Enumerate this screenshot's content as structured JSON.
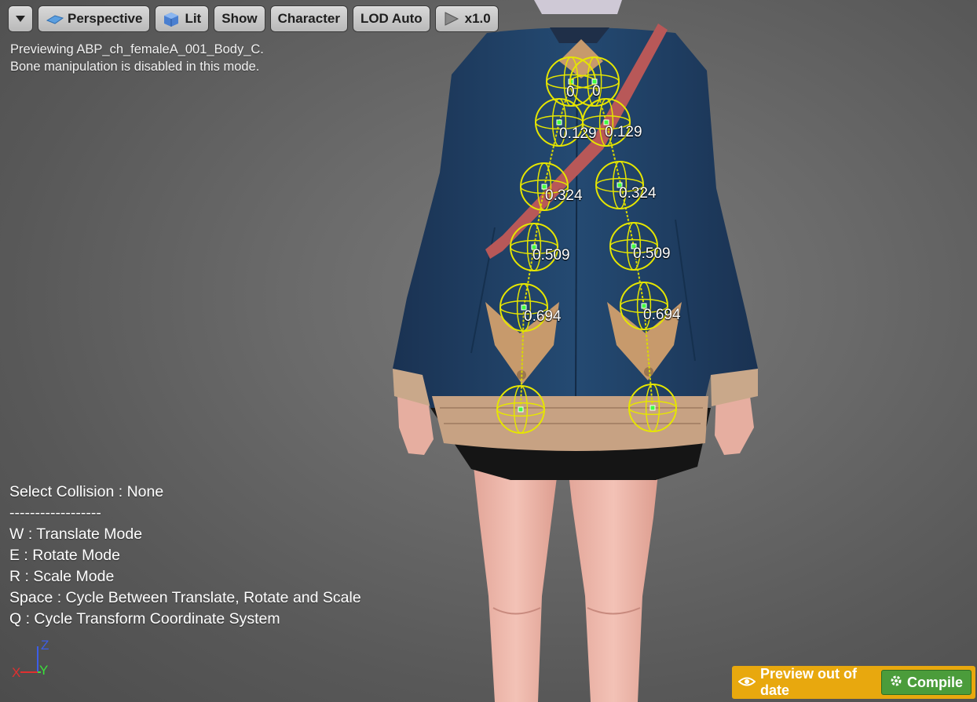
{
  "toolbar": {
    "menu_icon": "chevron-down-icon",
    "perspective_label": "Perspective",
    "lit_label": "Lit",
    "show_label": "Show",
    "character_label": "Character",
    "lod_label": "LOD Auto",
    "speed_label": "x1.0"
  },
  "overlay": {
    "line1": "Previewing ABP_ch_femaleA_001_Body_C.",
    "line2": "Bone manipulation is disabled in this mode."
  },
  "bone_weights": [
    "0",
    "0",
    "0.129",
    "0.129",
    "0.324",
    "0.324",
    "0.509",
    "0.509",
    "0.694",
    "0.694"
  ],
  "help": {
    "select_collision": "Select Collision : None",
    "divider": "------------------",
    "translate": "W : Translate Mode",
    "rotate": "E : Rotate Mode",
    "scale": "R : Scale Mode",
    "space": "Space : Cycle Between Translate, Rotate and Scale",
    "coord": "Q : Cycle Transform Coordinate System"
  },
  "axis": {
    "z": "Z",
    "y": "Y",
    "x": "X"
  },
  "status": {
    "preview_text": "Preview out of date",
    "compile_label": "Compile"
  },
  "colors": {
    "status_bar": "#e8a80e",
    "compile_button": "#4b9c3b",
    "gizmo": "#e6e600",
    "jacket": "#1c3a5c"
  }
}
